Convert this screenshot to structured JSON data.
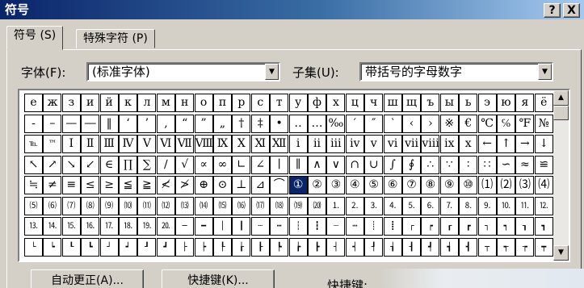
{
  "window": {
    "title": "符号",
    "help_button": "?",
    "close_button": "X"
  },
  "tabs": [
    {
      "label": "符号 (S)"
    },
    {
      "label": "特殊字符 (P)"
    }
  ],
  "font": {
    "label": "字体(F):",
    "value": "(标准字体)"
  },
  "subset": {
    "label": "子集(U):",
    "value": "带括号的字母数字"
  },
  "icons": {
    "dropdown": "triangle-down",
    "scroll_up": "triangle-up",
    "scroll_down": "triangle-down"
  },
  "colors": {
    "title_start": "#0a246a",
    "title_end": "#a6caf0",
    "selection": "#0a246a"
  },
  "symbol_grid": {
    "selected": {
      "row": 4,
      "col": 14
    },
    "rows": [
      [
        "е",
        "ж",
        "з",
        "и",
        "й",
        "к",
        "л",
        "м",
        "н",
        "о",
        "п",
        "р",
        "с",
        "т",
        "у",
        "ф",
        "х",
        "ц",
        "ч",
        "ш",
        "щ",
        "ъ",
        "ы",
        "ь",
        "э",
        "ю",
        "я",
        "ё"
      ],
      [
        "-",
        "–",
        "—",
        "―",
        "‖",
        "‘",
        "’",
        "‚",
        "“",
        "”",
        "„",
        "†",
        "‡",
        "•",
        "‥",
        "…",
        "‰",
        "′",
        "″",
        "‵",
        "‹",
        "›",
        "※",
        "€",
        "℃",
        "℅",
        "℉",
        "№"
      ],
      [
        "℡",
        "™",
        "Ⅰ",
        "Ⅱ",
        "Ⅲ",
        "Ⅳ",
        "Ⅴ",
        "Ⅵ",
        "Ⅶ",
        "Ⅷ",
        "Ⅸ",
        "Ⅹ",
        "Ⅺ",
        "Ⅻ",
        "ⅰ",
        "ⅱ",
        "ⅲ",
        "ⅳ",
        "ⅴ",
        "ⅵ",
        "ⅶ",
        "ⅷ",
        "ⅸ",
        "ⅹ",
        "←",
        "↑",
        "→",
        "↓"
      ],
      [
        "↖",
        "↗",
        "↘",
        "↙",
        "∈",
        "∏",
        "∑",
        "∕",
        "√",
        "∝",
        "∞",
        "∟",
        "∠",
        "∣",
        "∥",
        "∧",
        "∨",
        "∩",
        "∪",
        "∫",
        "∮",
        "∴",
        "∵",
        "∶",
        "∷",
        "∽",
        "≈",
        "≌"
      ],
      [
        "≒",
        "≠",
        "≡",
        "≤",
        "≥",
        "≦",
        "≧",
        "≮",
        "≯",
        "⊕",
        "⊙",
        "⊥",
        "⊿",
        "⌒",
        "①",
        "②",
        "③",
        "④",
        "⑤",
        "⑥",
        "⑦",
        "⑧",
        "⑨",
        "⑩",
        "⑴",
        "⑵",
        "⑶",
        "⑷"
      ],
      [
        "⑸",
        "⑹",
        "⑺",
        "⑻",
        "⑼",
        "⑽",
        "⑾",
        "⑿",
        "⒀",
        "⒁",
        "⒂",
        "⒃",
        "⒄",
        "⒅",
        "⒆",
        "⒇",
        "⒈",
        "⒉",
        "⒊",
        "⒋",
        "⒌",
        "⒍",
        "⒎",
        "⒏",
        "⒐",
        "⒑",
        "⒒",
        "⒓"
      ],
      [
        "⒔",
        "⒕",
        "⒖",
        "⒗",
        "⒘",
        "⒙",
        "⒚",
        "⒛",
        "─",
        "━",
        "│",
        "┃",
        "┄",
        "┅",
        "┆",
        "┇",
        "┈",
        "┉",
        "┊",
        "┋",
        "┌",
        "┍",
        "┎",
        "┏",
        "┐",
        "┑",
        "┒",
        "┓"
      ],
      [
        "└",
        "┕",
        "┖",
        "┗",
        "┘",
        "┙",
        "┚",
        "┛",
        "├",
        "┝",
        "┞",
        "┟",
        "┠",
        "┡",
        "┢",
        "┣",
        "┤",
        "┥",
        "┦",
        "┧",
        "┨",
        "┩",
        "┪",
        "┫",
        "┬",
        "┭",
        "┮",
        "┯"
      ]
    ]
  },
  "buttons": {
    "autocorrect": "自动更正(A)...",
    "shortcut_key": "快捷键(K)..."
  },
  "shortcut_label": "快捷键:"
}
